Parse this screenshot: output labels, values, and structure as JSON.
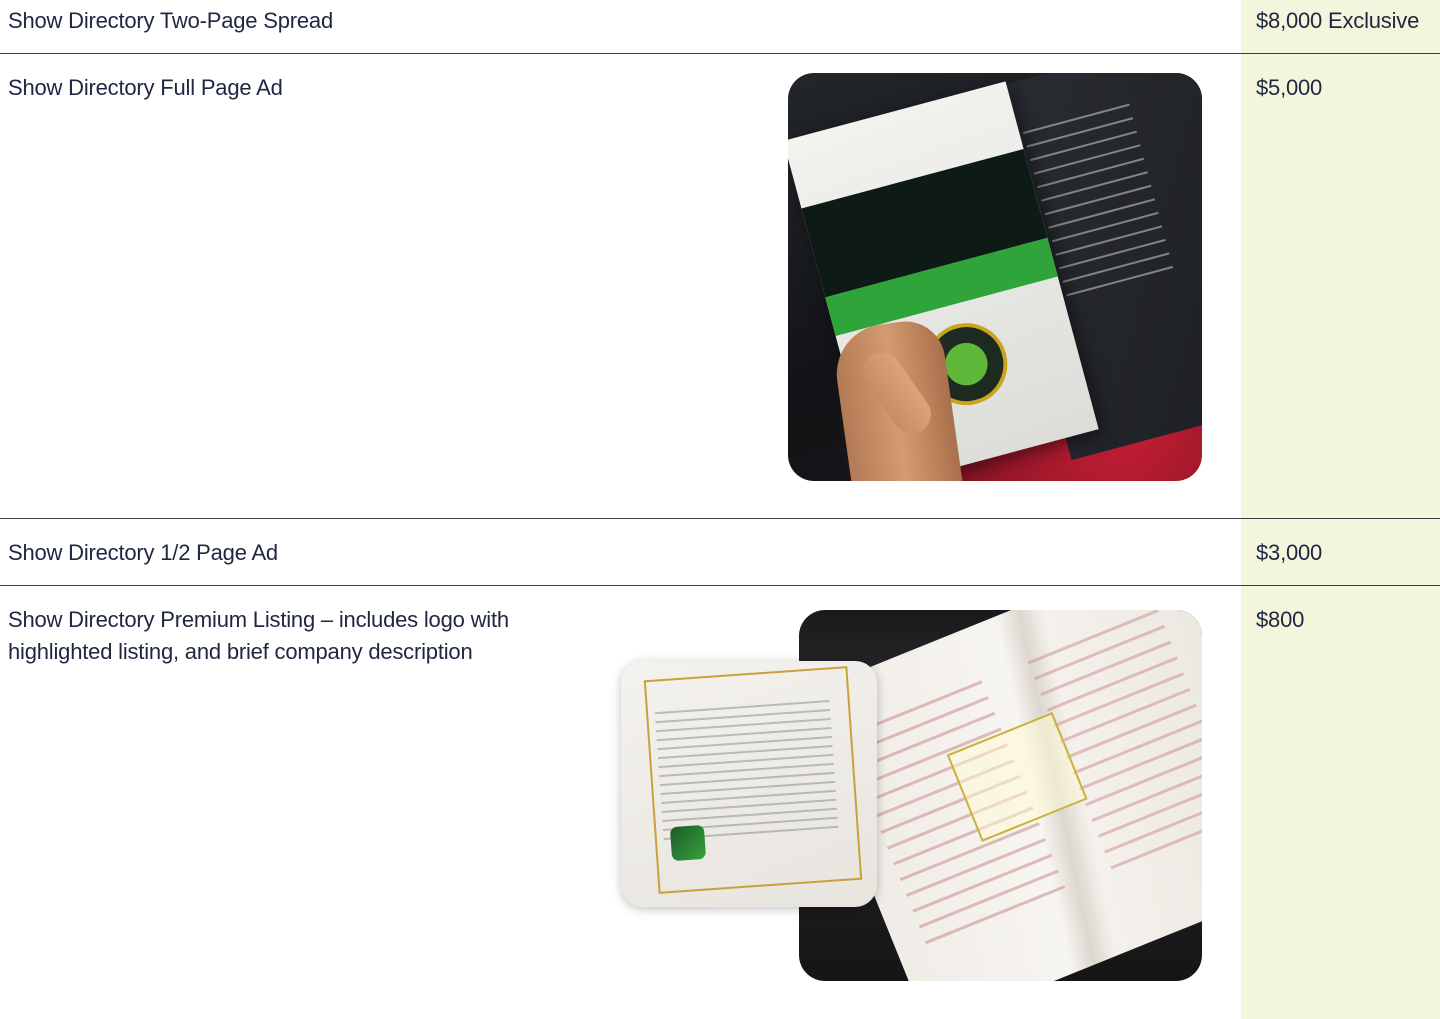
{
  "rows": [
    {
      "title": "Show Directory Two-Page Spread",
      "price": "$8,000 Exclusive"
    },
    {
      "title": "Show Directory Full Page Ad",
      "price": "$5,000"
    },
    {
      "title": "Show Directory 1/2 Page Ad",
      "price": "$3,000"
    },
    {
      "title_line1": "Show Directory Premium Listing – includes logo with",
      "title_line2": "highlighted listing, and brief company description",
      "price": "$800"
    }
  ],
  "colors": {
    "price_column": "#f3f5dc",
    "text": "#1f2740",
    "rule": "#3b3f4a"
  },
  "images": {
    "full_page_ad_photo": "hand-holding-show-directory-photo",
    "premium_listing_photo": "open-directory-listing-photo",
    "premium_listing_inset": "zoomed-listing-inset-photo"
  }
}
